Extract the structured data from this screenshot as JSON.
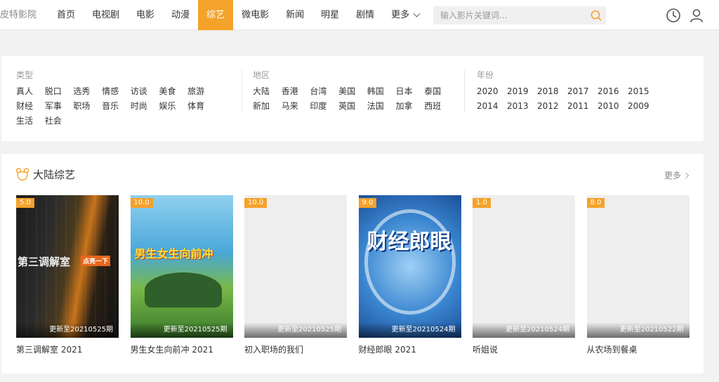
{
  "header": {
    "logo": "皮特影院",
    "nav": [
      "首页",
      "电视剧",
      "电影",
      "动漫",
      "综艺",
      "微电影",
      "新闻",
      "明星",
      "剧情"
    ],
    "active_nav": "综艺",
    "more_label": "更多",
    "search_placeholder": "输入影片关键词..."
  },
  "filters": {
    "type": {
      "title": "类型",
      "options": [
        "真人",
        "脱口",
        "选秀",
        "情感",
        "访谈",
        "美食",
        "旅游",
        "财经",
        "军事",
        "职场",
        "音乐",
        "时尚",
        "娱乐",
        "体育",
        "生活",
        "社会"
      ]
    },
    "region": {
      "title": "地区",
      "options": [
        "大陆",
        "香港",
        "台湾",
        "美国",
        "韩国",
        "日本",
        "泰国",
        "新加",
        "马来",
        "印度",
        "英国",
        "法国",
        "加拿",
        "西班"
      ]
    },
    "year": {
      "title": "年份",
      "options": [
        "2020",
        "2019",
        "2018",
        "2017",
        "2016",
        "2015",
        "2014",
        "2013",
        "2012",
        "2011",
        "2010",
        "2009"
      ]
    }
  },
  "section": {
    "title": "大陆综艺",
    "more_label": "更多",
    "items": [
      {
        "title": "第三调解室 2021",
        "score": "5.0",
        "update": "更新至20210525期",
        "poster_art": {
          "main": "第三调解室",
          "tag": "点亮一下"
        }
      },
      {
        "title": "男生女生向前冲 2021",
        "score": "10.0",
        "update": "更新至20210525期",
        "poster_art": {
          "main": "男生女生向前冲"
        }
      },
      {
        "title": "初入职场的我们",
        "score": "10.0",
        "update": "更新至20210525期"
      },
      {
        "title": "财经郎眼 2021",
        "score": "9.0",
        "update": "更新至20210524期",
        "poster_art": {
          "main": "财经郎眼"
        }
      },
      {
        "title": "听姐说",
        "score": "1.0",
        "update": "更新至20210524期"
      },
      {
        "title": "从农场到餐桌",
        "score": "8.0",
        "update": "更新至20210522期"
      }
    ]
  },
  "colors": {
    "accent": "#f5a22a",
    "background": "#f2f2f2"
  },
  "icons": [
    "search-icon",
    "history-clock-icon",
    "user-icon",
    "bear-icon",
    "chevron-down-icon",
    "chevron-right-icon"
  ]
}
